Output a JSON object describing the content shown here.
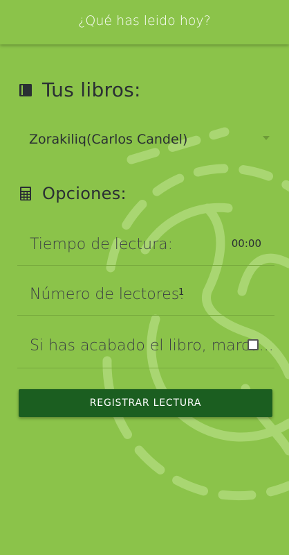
{
  "header": {
    "title": "¿Qué has leido hoy?"
  },
  "books_section": {
    "title": "Tus libros:",
    "icon": "book-icon",
    "selected_book": "Zorakiliq(Carlos Candel)"
  },
  "options_section": {
    "title": "Opciones:",
    "icon": "calculator-icon",
    "reading_time_label": "Tiempo de lectura:",
    "reading_time_value": "00:00",
    "readers_label": "Número de lectores:",
    "readers_value": "1",
    "finished_label": "Si has acabado el libro, marca...",
    "finished_checked": false
  },
  "actions": {
    "register_button": "REGISTRAR LECTURA"
  },
  "colors": {
    "background": "#8bc34a",
    "button": "#1b5e20",
    "decoration": "#a9d672"
  }
}
